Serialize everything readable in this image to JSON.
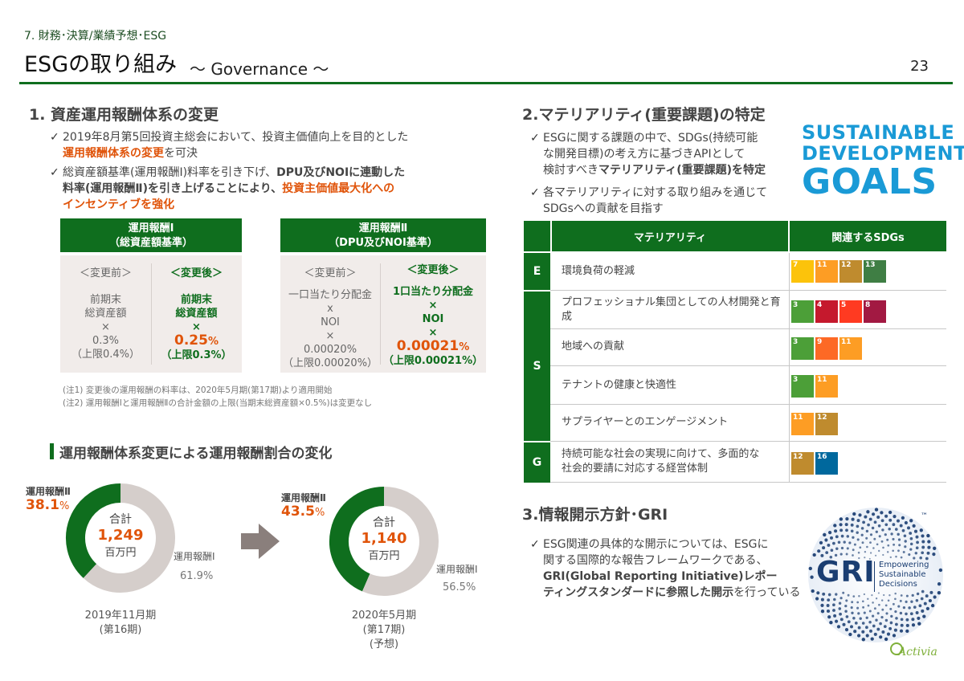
{
  "header": {
    "section": "7. 財務･決算/業績予想･ESG",
    "title": "ESGの取り組み",
    "subtitle": "～ Governance ～",
    "page_number": "23"
  },
  "s1": {
    "heading": "1. 資産運用報酬体系の変更",
    "b1_line1": "2019年8月第5回投資主総会において、投資主価値向上を目的とした",
    "b1_line2_hl": "運用報酬体系の変更",
    "b1_line2_rest": "を可決",
    "b2_line1_a": "総資産額基準(運用報酬Ⅰ)料率を引き下げ、",
    "b2_line1_b": "DPU及びNOIに連動した",
    "b2_line2_a": "料率(運用報酬Ⅱ)を引き上げることにより、",
    "b2_line2_b": "投資主価値最大化への",
    "b2_line3": "インセンティブを強化"
  },
  "fee1": {
    "head1": "運用報酬Ⅰ",
    "head2": "（総資産額基準）",
    "before_label": "＜変更前＞",
    "before_l1": "前期末",
    "before_l2": "総資産額",
    "before_l3": "×",
    "before_l4": "0.3%",
    "before_l5": "（上限0.4%）",
    "after_label": "＜変更後＞",
    "after_l1": "前期末",
    "after_l2": "総資産額",
    "after_l3": "×",
    "after_value": "0.25",
    "after_pct": "%",
    "after_l5": "（上限0.3%）"
  },
  "fee2": {
    "head1": "運用報酬Ⅱ",
    "head2": "（DPU及びNOI基準）",
    "before_label": "＜変更前＞",
    "before_l1": "一口当たり分配金",
    "before_l2": "x",
    "before_l3": "NOI",
    "before_l4": "×",
    "before_l5": "0.00020%",
    "before_l6": "（上限0.00020%）",
    "after_label": "＜変更後＞",
    "after_l1": "1口当たり分配金",
    "after_l2": "×",
    "after_l3": "NOI",
    "after_l4": "×",
    "after_value": "0.00021",
    "after_pct": "%",
    "after_l6": "（上限0.00021%）"
  },
  "notes": {
    "n1": "(注1) 変更後の運用報酬の料率は、2020年5月期(第17期)より適用開始",
    "n2": "(注2) 運用報酬Ⅰと運用報酬Ⅱの合計金額の上限(当期末総資産額×0.5%)は変更なし"
  },
  "ratio": {
    "heading": "運用報酬体系変更による運用報酬割合の変化"
  },
  "chart_data": [
    {
      "type": "pie",
      "categories": [
        "運用報酬Ⅱ",
        "運用報酬Ⅰ"
      ],
      "values": [
        38.1,
        61.9
      ],
      "total_label": "合計",
      "total_value": "1,249",
      "total_unit": "百万円",
      "label_fee2": "運用報酬Ⅱ",
      "value_fee2": "38.1",
      "label_fee1": "運用報酬Ⅰ",
      "value_fee1": "61.9%",
      "period_l1": "2019年11月期",
      "period_l2": "(第16期)",
      "period_l3": "",
      "colors": [
        "#0f6e1e",
        "#d5cecb"
      ]
    },
    {
      "type": "pie",
      "categories": [
        "運用報酬Ⅱ",
        "運用報酬Ⅰ"
      ],
      "values": [
        43.5,
        56.5
      ],
      "total_label": "合計",
      "total_value": "1,140",
      "total_unit": "百万円",
      "label_fee2": "運用報酬Ⅱ",
      "value_fee2": "43.5",
      "label_fee1": "運用報酬Ⅰ",
      "value_fee1": "56.5%",
      "period_l1": "2020年5月期",
      "period_l2": "(第17期)",
      "period_l3": "(予想)",
      "colors": [
        "#0f6e1e",
        "#d5cecb"
      ]
    }
  ],
  "pct_sign": "%",
  "s2": {
    "heading": "2.マテリアリティ(重要課題)の特定",
    "b1_l1": "ESGに関する課題の中で、SDGs(持続可能",
    "b1_l2": "な開発目標)の考え方に基づきAPIとして",
    "b1_l3_a": "検討すべき",
    "b1_l3_b": "マテリアリティ(重要課題)を特定",
    "b2_l1": "各マテリアリティに対する取り組みを通じて",
    "b2_l2": "SDGsへの貢献を目指す",
    "sdg_logo_l1": "SUSTAINABLE",
    "sdg_logo_l2": "DEVELOPMENT",
    "sdg_logo_l3": "GOALS"
  },
  "materiality": {
    "col1": "マテリアリティ",
    "col2": "関連するSDGs",
    "rows": [
      {
        "letter": "E",
        "text": "環境負荷の軽減",
        "sdgs": [
          "7",
          "11",
          "12",
          "13"
        ]
      },
      {
        "letter": "S",
        "text": "プロフェッショナル集団としての人材開発と育成",
        "sdgs": [
          "3",
          "4",
          "5",
          "8"
        ]
      },
      {
        "letter": "",
        "text": "地域への貢献",
        "sdgs": [
          "3",
          "9",
          "11"
        ]
      },
      {
        "letter": "",
        "text": "テナントの健康と快適性",
        "sdgs": [
          "3",
          "11"
        ]
      },
      {
        "letter": "",
        "text": "サプライヤーとのエンゲージメント",
        "sdgs": [
          "11",
          "12"
        ]
      },
      {
        "letter": "G",
        "text_l1": "持続可能な社会の実現に向けて、多面的な",
        "text_l2": "社会的要請に対応する経営体制",
        "sdgs": [
          "12",
          "16"
        ]
      }
    ]
  },
  "s3": {
    "heading": "3.情報開示方針･GRI",
    "l1": "ESG関連の具体的な開示については、ESGに",
    "l2": "関する国際的な報告フレームワークである、",
    "l3": "GRI(Global Reporting Initiative)レポー",
    "l4_a": "ティングスタンダードに参照した開示",
    "l4_b": "を行っている",
    "gri_mark": "GRI",
    "gri_tag1": "Empowering",
    "gri_tag2": "Sustainable",
    "gri_tag3": "Decisions",
    "gri_tm": "™"
  },
  "footer": {
    "brand": "Activia"
  },
  "colors": {
    "accent": "#0f6e1e",
    "highlight": "#e0540a",
    "muted": "#d5cecb"
  }
}
